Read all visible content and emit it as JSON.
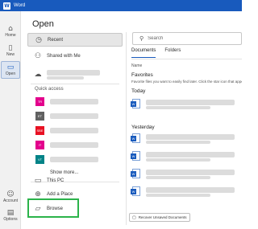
{
  "window": {
    "app_name": "Word",
    "app_icon": "word-icon"
  },
  "nav": {
    "items": [
      {
        "label": "Home",
        "icon": "home-icon"
      },
      {
        "label": "New",
        "icon": "new-document-icon"
      },
      {
        "label": "Open",
        "icon": "folder-open-icon",
        "active": true
      }
    ],
    "bottom": [
      {
        "label": "Account",
        "icon": "account-icon"
      },
      {
        "label": "Options",
        "icon": "options-icon"
      }
    ]
  },
  "open": {
    "heading": "Open",
    "locations": [
      {
        "label": "Recent",
        "icon": "clock-icon",
        "selected": true
      },
      {
        "label": "Shared with Me",
        "icon": "people-icon"
      }
    ],
    "quick_access_label": "Quick access",
    "quick_access": [
      {
        "initials": "TR",
        "color": "#e3008c"
      },
      {
        "initials": "ET",
        "color": "#616161"
      },
      {
        "initials": "SBE",
        "color": "#e81123"
      },
      {
        "initials": "IT",
        "color": "#e3008c"
      },
      {
        "initials": "VT",
        "color": "#038387"
      }
    ],
    "show_more": "Show more...",
    "places": [
      {
        "label": "This PC",
        "icon": "computer-icon"
      },
      {
        "label": "Add a Place",
        "icon": "globe-icon"
      },
      {
        "label": "Browse",
        "icon": "folder-icon"
      }
    ]
  },
  "files": {
    "search_placeholder": "Search",
    "tabs": [
      "Documents",
      "Folders"
    ],
    "active_tab": "Documents",
    "column_name": "Name",
    "favorites_title": "Favorites",
    "favorites_desc": "Favorite files you want to easily find later. Click the star icon that appears when you hover over a file.",
    "today_title": "Today",
    "yesterday_title": "Yesterday",
    "recover_label": "Recover Unsaved Documents"
  },
  "colors": {
    "brand": "#185abd",
    "highlight": "#2bb34a"
  }
}
